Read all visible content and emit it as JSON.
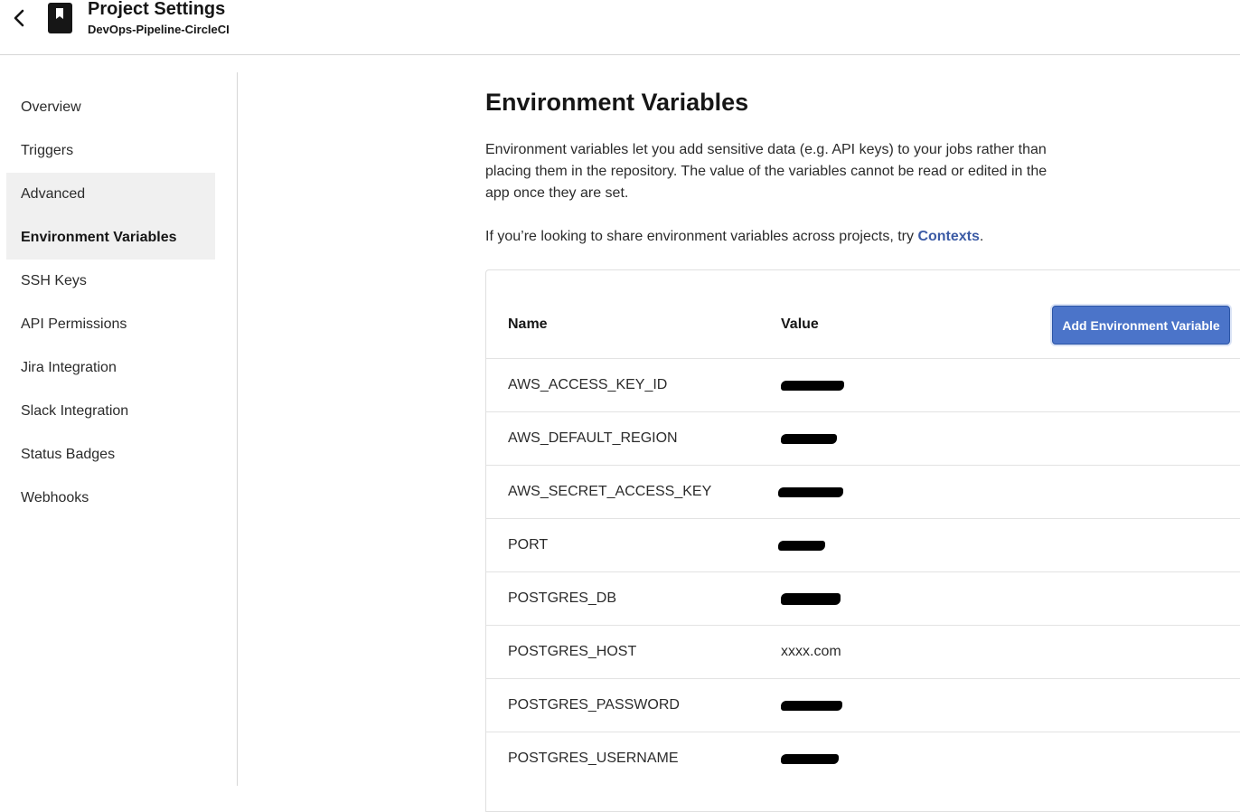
{
  "header": {
    "title": "Project Settings",
    "subtitle": "DevOps-Pipeline-CircleCI",
    "back_icon": "chevron-left-icon",
    "project_icon": "bookmark-icon"
  },
  "sidebar": {
    "items": [
      {
        "label": "Overview"
      },
      {
        "label": "Triggers"
      },
      {
        "label": "Advanced"
      },
      {
        "label": "Environment Variables",
        "active": true
      },
      {
        "label": "SSH Keys"
      },
      {
        "label": "API Permissions"
      },
      {
        "label": "Jira Integration"
      },
      {
        "label": "Slack Integration"
      },
      {
        "label": "Status Badges"
      },
      {
        "label": "Webhooks"
      }
    ]
  },
  "main": {
    "title": "Environment Variables",
    "description": "Environment variables let you add sensitive data (e.g. API keys) to your jobs rather than placing them in the repository. The value of the variables cannot be read or edited in the app once they are set.",
    "share_prefix": "If you’re looking to share environment variables across projects, try ",
    "contexts_link": "Contexts",
    "share_suffix": "."
  },
  "table": {
    "name_header": "Name",
    "value_header": "Value",
    "add_button": "Add Environment Variable",
    "rows": [
      {
        "name": "AWS_ACCESS_KEY_ID",
        "value": "",
        "redacted": true
      },
      {
        "name": "AWS_DEFAULT_REGION",
        "value": "",
        "redacted": true
      },
      {
        "name": "AWS_SECRET_ACCESS_KEY",
        "value": "",
        "redacted": true
      },
      {
        "name": "PORT",
        "value": "",
        "redacted": true
      },
      {
        "name": "POSTGRES_DB",
        "value": "",
        "redacted": true
      },
      {
        "name": "POSTGRES_HOST",
        "value": "xxxx.com",
        "redacted": false
      },
      {
        "name": "POSTGRES_PASSWORD",
        "value": "",
        "redacted": true
      },
      {
        "name": "POSTGRES_USERNAME",
        "value": "",
        "redacted": true
      }
    ]
  },
  "colors": {
    "accent": "#4b74c9",
    "link": "#3c5ba5",
    "sidebar_selected_bg": "#f0f0f0",
    "border": "#d6d6d6"
  }
}
